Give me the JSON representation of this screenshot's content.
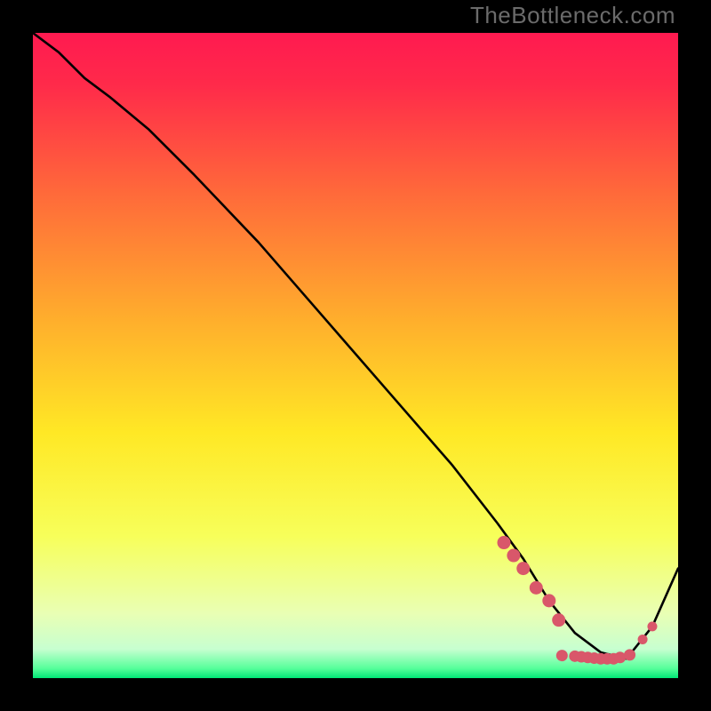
{
  "watermark": "TheBottleneck.com",
  "colors": {
    "gradient_stops": [
      {
        "offset": 0,
        "color": "#ff1a50"
      },
      {
        "offset": 0.08,
        "color": "#ff2a4a"
      },
      {
        "offset": 0.25,
        "color": "#ff6a3a"
      },
      {
        "offset": 0.45,
        "color": "#ffb02c"
      },
      {
        "offset": 0.62,
        "color": "#ffe825"
      },
      {
        "offset": 0.78,
        "color": "#f7ff5a"
      },
      {
        "offset": 0.9,
        "color": "#e9ffb4"
      },
      {
        "offset": 0.955,
        "color": "#c7ffd0"
      },
      {
        "offset": 0.985,
        "color": "#56ff9a"
      },
      {
        "offset": 1.0,
        "color": "#00e676"
      }
    ],
    "curve": "#000000",
    "marker": "#d9576a"
  },
  "chart_data": {
    "type": "line",
    "title": "",
    "xlabel": "",
    "ylabel": "",
    "xlim": [
      0,
      100
    ],
    "ylim": [
      0,
      100
    ],
    "series": [
      {
        "name": "curve",
        "x": [
          0,
          4,
          8,
          12,
          18,
          25,
          35,
          45,
          55,
          65,
          72,
          76,
          80,
          84,
          88,
          92,
          96,
          100
        ],
        "y": [
          100,
          97,
          93,
          90,
          85,
          78,
          67.5,
          56,
          44.5,
          33,
          24,
          18.5,
          12,
          7,
          4,
          3,
          8,
          17
        ]
      }
    ],
    "markers": {
      "name": "highlight-dots",
      "points": [
        {
          "x": 73,
          "y": 21
        },
        {
          "x": 74.5,
          "y": 19
        },
        {
          "x": 76,
          "y": 17
        },
        {
          "x": 78,
          "y": 14
        },
        {
          "x": 80,
          "y": 12
        },
        {
          "x": 81.5,
          "y": 9
        }
      ],
      "flat_points": [
        {
          "x": 82,
          "y": 3.5
        },
        {
          "x": 84,
          "y": 3.4
        },
        {
          "x": 85,
          "y": 3.3
        },
        {
          "x": 86,
          "y": 3.2
        },
        {
          "x": 87,
          "y": 3.1
        },
        {
          "x": 88,
          "y": 3.0
        },
        {
          "x": 89,
          "y": 3.0
        },
        {
          "x": 90,
          "y": 3.0
        },
        {
          "x": 91,
          "y": 3.2
        },
        {
          "x": 92.5,
          "y": 3.6
        }
      ],
      "extra_points": [
        {
          "x": 94.5,
          "y": 6
        },
        {
          "x": 96,
          "y": 8
        }
      ]
    }
  }
}
